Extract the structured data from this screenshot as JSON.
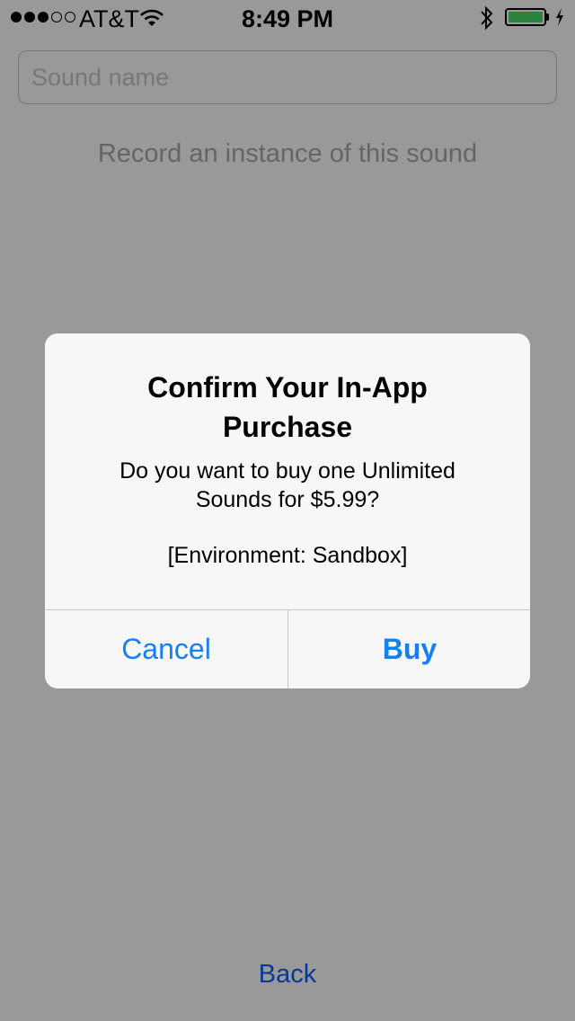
{
  "status_bar": {
    "signal_filled": 3,
    "signal_total": 5,
    "carrier": "AT&T",
    "time": "8:49 PM",
    "battery_level": 1.0,
    "battery_color": "#4cd964",
    "icons": [
      "wifi-icon",
      "bluetooth-icon",
      "battery-icon",
      "charging-icon"
    ]
  },
  "form": {
    "sound_name_placeholder": "Sound name",
    "sound_name_value": "",
    "record_label": "Record an instance of this sound"
  },
  "alert": {
    "title_lines": [
      "Confirm Your In-App",
      "Purchase"
    ],
    "message_lines": [
      "Do you want to buy one Unlimited",
      "Sounds for $5.99?"
    ],
    "environment": "[Environment: Sandbox]",
    "cancel_label": "Cancel",
    "buy_label": "Buy"
  },
  "footer": {
    "back_label": "Back"
  },
  "colors": {
    "tint": "#147efb",
    "back_tint": "#0a60ff",
    "overlay": "rgba(0,0,0,0.4)"
  }
}
